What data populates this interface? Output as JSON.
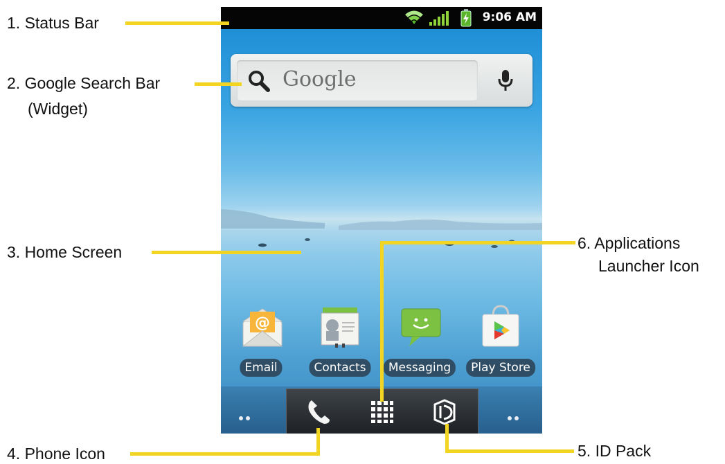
{
  "callouts": {
    "status_bar": "1. Status Bar",
    "search_bar_line1": "2. Google Search Bar",
    "search_bar_line2": "(Widget)",
    "home_screen": "3. Home Screen",
    "phone_icon": "4. Phone Icon",
    "id_pack": "5. ID Pack",
    "launcher_line1": "6. Applications",
    "launcher_line2": "Launcher Icon"
  },
  "status_bar": {
    "time": "9:06 AM",
    "icons": [
      "wifi-icon",
      "signal-icon",
      "battery-charging-icon"
    ]
  },
  "search_widget": {
    "text": "Google",
    "icons": [
      "search-icon",
      "microphone-icon"
    ]
  },
  "apps": [
    {
      "label": "Email",
      "icon": "email-icon"
    },
    {
      "label": "Contacts",
      "icon": "contacts-icon"
    },
    {
      "label": "Messaging",
      "icon": "messaging-icon"
    },
    {
      "label": "Play Store",
      "icon": "play-store-icon"
    }
  ],
  "dock": {
    "icons": [
      "phone-icon",
      "app-launcher-icon",
      "id-pack-icon"
    ]
  },
  "colors": {
    "leader_line": "#f2d422",
    "status_bar": "#050505"
  }
}
